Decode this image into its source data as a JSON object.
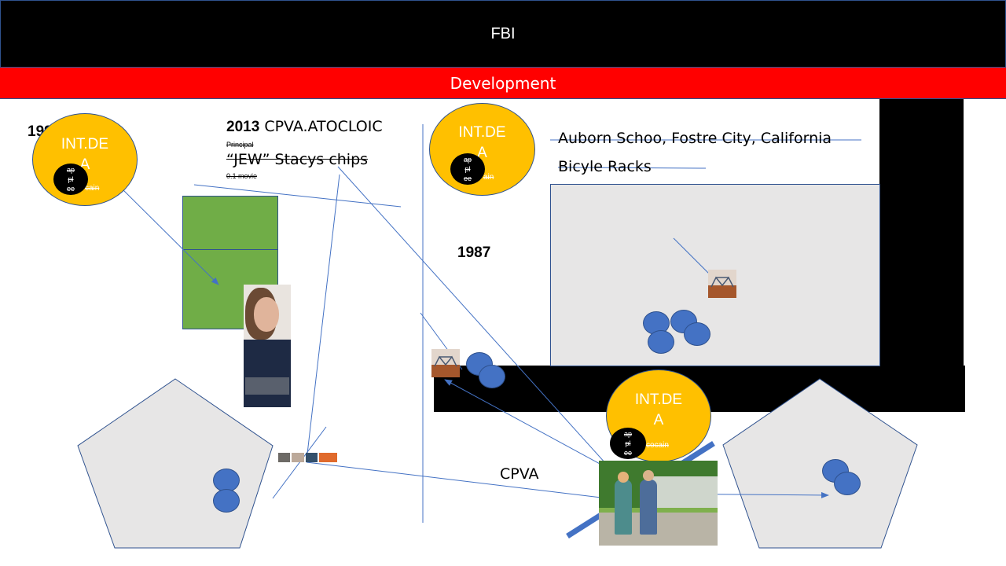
{
  "header": {
    "title": "FBI"
  },
  "subheader": {
    "title": "Development"
  },
  "years": {
    "left": "1990",
    "middle": "1987"
  },
  "circle_left": {
    "title": "INT.DE A",
    "mini": [
      "ap",
      "pl",
      "ee"
    ],
    "side_text": "cain"
  },
  "circle_middle": {
    "title": "INT.DE A",
    "mini": [
      "ap",
      "pl",
      "ee"
    ],
    "side_text": "ain"
  },
  "circle_bottom": {
    "title": "INT.DE A",
    "mini": [
      "ap",
      "pl",
      "ee"
    ],
    "side_text": "cocain"
  },
  "headline": {
    "year": "2013",
    "org": "CPVA.ATOCLOIC",
    "sub1": "Principal",
    "line2": "“JEW” Stacys chips",
    "sub2": "0.1 movie"
  },
  "location": {
    "line1": "Auborn Schoo, Fostre City, California",
    "line2": "Bicyle Racks"
  },
  "label_cpva": "CPVA",
  "icons": {
    "bike_large": "bicycle-rack-icon",
    "bike_small": "bicycle-rack-icon",
    "photo_woman": "woman-portrait-photo",
    "photo_walkers": "people-walking-photo",
    "thumbnails": "thumbnail-strip"
  },
  "colors": {
    "header": "#000000",
    "subheader": "#ff0000",
    "circle_fill": "#ffc000",
    "dot_fill": "#4472c4",
    "green_box": "#70ad47",
    "grey_shape": "#e7e6e6",
    "line": "#4472c4"
  }
}
